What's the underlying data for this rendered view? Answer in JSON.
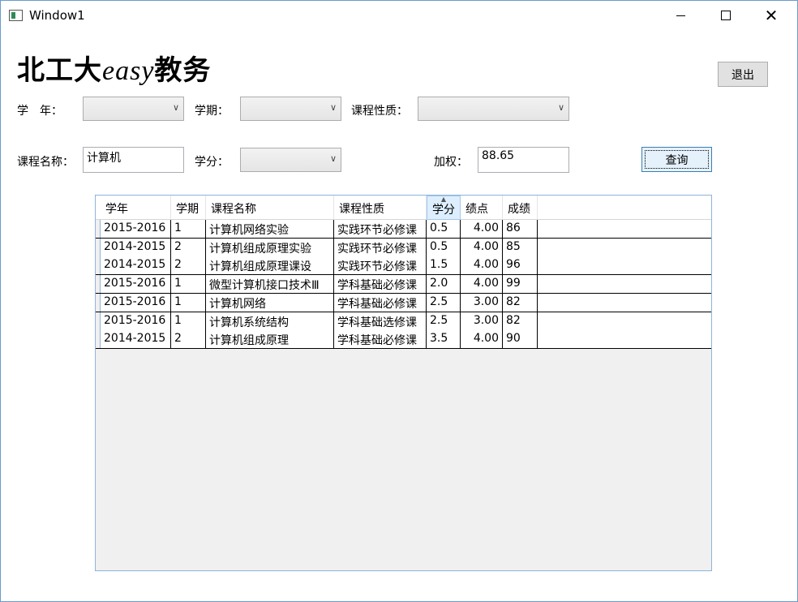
{
  "window": {
    "title": "Window1"
  },
  "logo": {
    "main": "北工大",
    "easy": "easy",
    "suffix": "教务"
  },
  "buttons": {
    "exit": "退出",
    "query": "查询"
  },
  "filters": {
    "year_label": "学　年：",
    "term_label": "学期：",
    "nature_label": "课程性质：",
    "course_label": "课程名称：",
    "course_value": "计算机",
    "credit_label": "学分：",
    "weighted_label": "加权：",
    "weighted_value": "88.65"
  },
  "grid": {
    "columns": [
      "学年",
      "学期",
      "课程名称",
      "课程性质",
      "学分",
      "绩点",
      "成绩"
    ],
    "sorted_column": "学分",
    "rows": [
      [
        "2015-2016",
        "1",
        "计算机网络实验",
        "实践环节必修课",
        "0.5",
        "4.00",
        "86"
      ],
      [
        "2014-2015",
        "2",
        "计算机组成原理实验",
        "实践环节必修课",
        "0.5",
        "4.00",
        "85"
      ],
      [
        "2014-2015",
        "2",
        "计算机组成原理课设",
        "实践环节必修课",
        "1.5",
        "4.00",
        "96"
      ],
      [
        "2015-2016",
        "1",
        "微型计算机接口技术Ⅲ",
        "学科基础必修课",
        "2.0",
        "4.00",
        "99"
      ],
      [
        "2015-2016",
        "1",
        "计算机网络",
        "学科基础必修课",
        "2.5",
        "3.00",
        "82"
      ],
      [
        "2015-2016",
        "1",
        "计算机系统结构",
        "学科基础选修课",
        "2.5",
        "3.00",
        "82"
      ],
      [
        "2014-2015",
        "2",
        "计算机组成原理",
        "学科基础必修课",
        "3.5",
        "4.00",
        "90"
      ]
    ]
  }
}
